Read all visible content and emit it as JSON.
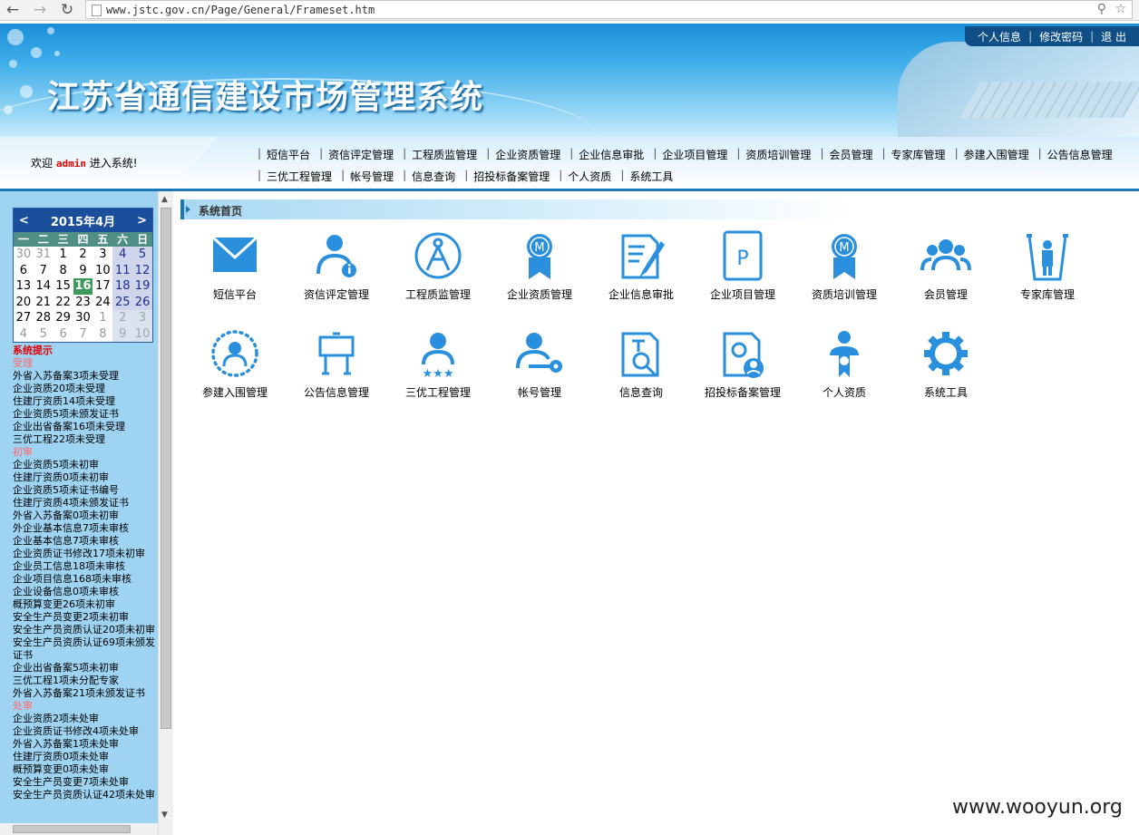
{
  "browser": {
    "url": "www.jstc.gov.cn/Page/General/Frameset.htm",
    "back_icon": "back-arrow-icon",
    "forward_icon": "forward-arrow-icon",
    "reload_icon": "reload-icon"
  },
  "header": {
    "system_title": "江苏省通信建设市场管理系统",
    "top_links": [
      "个人信息",
      "修改密码",
      "退 出"
    ]
  },
  "welcome": {
    "prefix": "欢迎",
    "user": "admin",
    "suffix": "进入系统!"
  },
  "menu": {
    "row1": [
      "短信平台",
      "资信评定管理",
      "工程质监管理",
      "企业资质管理",
      "企业信息审批",
      "企业项目管理",
      "资质培训管理",
      "会员管理",
      "专家库管理",
      "参建入围管理",
      "公告信息管理"
    ],
    "row2": [
      "三优工程管理",
      "帐号管理",
      "信息查询",
      "招投标备案管理",
      "个人资质",
      "系统工具"
    ]
  },
  "calendar": {
    "title": "2015年4月",
    "prev": "<",
    "next": ">",
    "weekdays": [
      "一",
      "二",
      "三",
      "四",
      "五",
      "六",
      "日"
    ],
    "days": [
      [
        "30",
        "31",
        "1",
        "2",
        "3",
        "4",
        "5"
      ],
      [
        "6",
        "7",
        "8",
        "9",
        "10",
        "11",
        "12"
      ],
      [
        "13",
        "14",
        "15",
        "16",
        "17",
        "18",
        "19"
      ],
      [
        "20",
        "21",
        "22",
        "23",
        "24",
        "25",
        "26"
      ],
      [
        "27",
        "28",
        "29",
        "30",
        "1",
        "2",
        "3"
      ],
      [
        "4",
        "5",
        "6",
        "7",
        "8",
        "9",
        "10"
      ]
    ],
    "today": "16"
  },
  "tips": {
    "title": "系统提示",
    "sections": [
      {
        "category": "受理",
        "items": [
          "外省入苏备案3项未受理",
          "企业资质20项未受理",
          "住建厅资质14项未受理",
          "企业资质5项未颁发证书",
          "企业出省备案16项未受理",
          "三优工程22项未受理"
        ]
      },
      {
        "category": "初审",
        "items": [
          "企业资质5项未初审",
          "住建厅资质0项未初审",
          "企业资质5项未证书编号",
          "住建厅资质4项未颁发证书",
          "外省入苏备案0项未初审",
          "外企业基本信息7项未审核",
          "企业基本信息7项未审核",
          "企业资质证书修改17项未初审",
          "企业员工信息18项未审核",
          "企业项目信息168项未审核",
          "企业设备信息0项未审核",
          "概预算变更26项未初审",
          "安全生产员变更2项未初审",
          "安全生产员资质认证20项未初审",
          "安全生产员资质认证69项未颁发证书",
          "企业出省备案5项未初审",
          "三优工程1项未分配专家",
          "外省入苏备案21项未颁发证书"
        ]
      },
      {
        "category": "处审",
        "items": [
          "企业资质2项未处审",
          "企业资质证书修改4项未处审",
          "外省入苏备案1项未处审",
          "住建厅资质0项未处审",
          "概预算变更0项未处审",
          "安全生产员变更7项未处审",
          "安全生产员资质认证42项未处审"
        ]
      }
    ]
  },
  "main": {
    "breadcrumb": "系统首页",
    "tiles": [
      {
        "label": "短信平台",
        "icon": "envelope-icon"
      },
      {
        "label": "资信评定管理",
        "icon": "user-info-icon"
      },
      {
        "label": "工程质监管理",
        "icon": "compass-icon"
      },
      {
        "label": "企业资质管理",
        "icon": "medal-badge-icon"
      },
      {
        "label": "企业信息审批",
        "icon": "document-pen-icon"
      },
      {
        "label": "企业项目管理",
        "icon": "project-p-icon"
      },
      {
        "label": "资质培训管理",
        "icon": "medal-badge-icon"
      },
      {
        "label": "会员管理",
        "icon": "group-members-icon"
      },
      {
        "label": "专家库管理",
        "icon": "expert-bin-icon"
      },
      {
        "label": "参建入围管理",
        "icon": "user-circle-dots-icon"
      },
      {
        "label": "公告信息管理",
        "icon": "billboard-icon"
      },
      {
        "label": "三优工程管理",
        "icon": "user-stars-icon"
      },
      {
        "label": "帐号管理",
        "icon": "user-key-icon"
      },
      {
        "label": "信息查询",
        "icon": "document-search-icon"
      },
      {
        "label": "招投标备案管理",
        "icon": "document-user-icon"
      },
      {
        "label": "个人资质",
        "icon": "person-award-icon"
      },
      {
        "label": "系统工具",
        "icon": "gear-icon"
      }
    ]
  },
  "watermark": "www.wooyun.org",
  "colors": {
    "icon_blue": "#2a8fdc",
    "header_blue": "#1a8fd8",
    "menu_line": "#1b78b8",
    "alert_red": "#e00000",
    "today_green": "#3e9a5c"
  }
}
